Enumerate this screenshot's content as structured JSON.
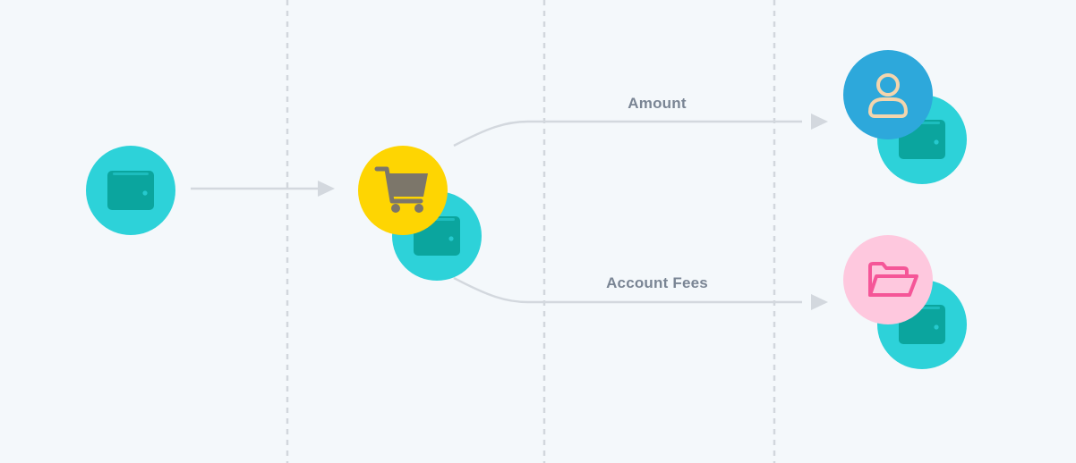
{
  "labels": {
    "top_flow": "Amount",
    "bottom_flow": "Account Fees"
  },
  "nodes": {
    "source": {
      "icon": "wallet-icon"
    },
    "checkout": {
      "icon": "shopping-cart-icon",
      "secondary_icon": "wallet-icon"
    },
    "recipient_user": {
      "icon": "user-icon",
      "secondary_icon": "wallet-icon"
    },
    "recipient_fees": {
      "icon": "folder-open-icon",
      "secondary_icon": "wallet-icon"
    }
  },
  "colors": {
    "background": "#f4f8fb",
    "wallet_circle": "#2dd2d9",
    "wallet_icon": "#0ba59e",
    "cart_circle": "#fed502",
    "cart_icon": "#7c766a",
    "user_circle": "#2da8db",
    "user_icon": "#f3d5ad",
    "folder_circle": "#fec8de",
    "folder_icon": "#f55698",
    "connector": "#d3d8de",
    "divider": "#d2d7dd",
    "label_text": "#7a8594"
  }
}
